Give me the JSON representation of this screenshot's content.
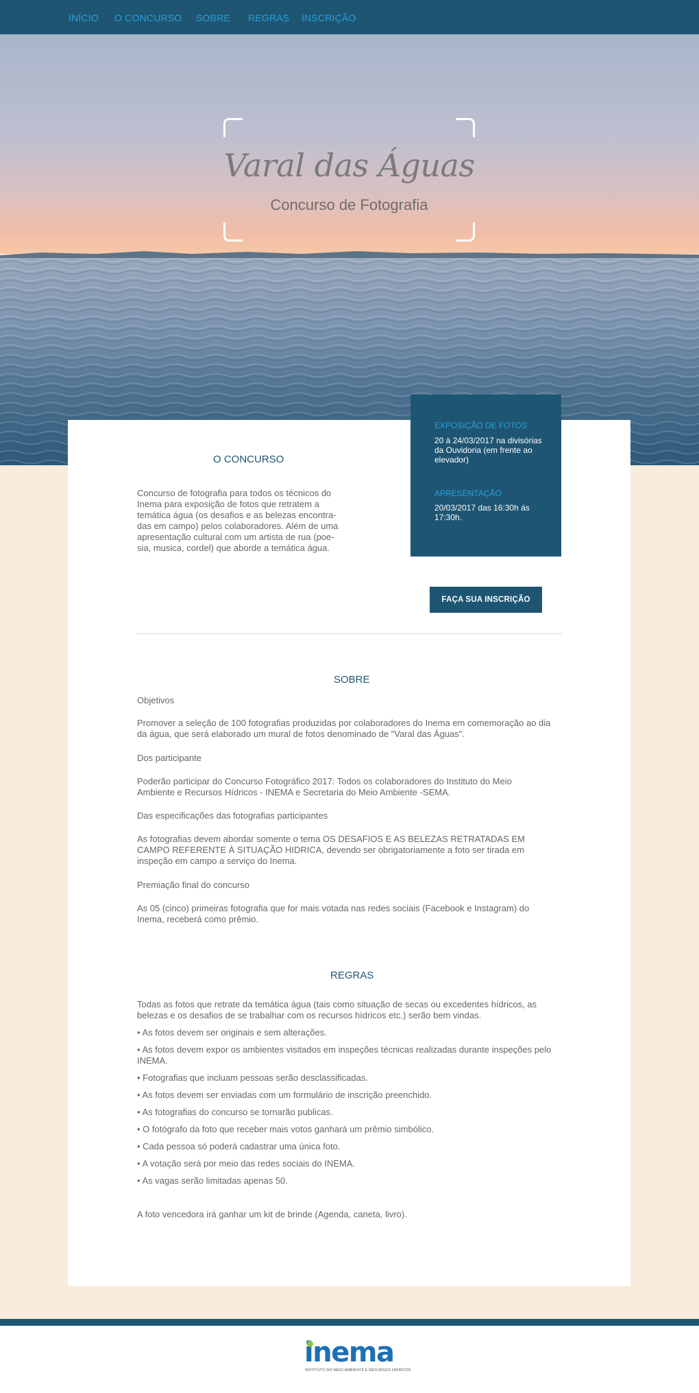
{
  "nav": {
    "items": [
      "INÍCIO",
      "O CONCURSO",
      "SOBRE",
      "REGRAS",
      "INSCRIÇÃO"
    ]
  },
  "hero": {
    "title": "Varal das Águas",
    "subtitle": "Concurso de Fotografia"
  },
  "info_box": {
    "exhibition_heading": "EXPOSIÇÃO DE FOTOS",
    "exhibition_text": "20 à 24/03/2017 na divisórias da Ouvidoria (em frente ao elevador)",
    "presentation_heading": "APRESENTAÇÃO",
    "presentation_text": "20/03/2017 das 16:30h ás 17:30h."
  },
  "concurso": {
    "title": "O CONCURSO",
    "text": "Concurso de fotografia para todos os técnicos do Inema para exposição de fotos que retratem a temática água (os desafios e as belezas encontra-das em campo) pelos colaboradores. Além de uma apresentação cultural com um artista de rua (poe-sia, musica, cordel) que aborde a temática água."
  },
  "cta": {
    "label": "FAÇA SUA INSCRIÇÃO"
  },
  "sobre": {
    "title": "SOBRE",
    "objetivos_label": "Objetivos",
    "objetivos_text": "Promover a seleção de 100 fotografias produzidas por colaboradores do Inema em comemoração ao dia da água, que será elaborado um mural de fotos denominado de \"Varal das Águas\".",
    "participantes_label": "Dos participante",
    "participantes_text": "Poderão participar do Concurso Fotográfico 2017: Todos os colaboradores do Instituto do Meio Ambiente e Recursos Hídricos - INEMA e Secretaria do Meio Ambiente -SEMA.",
    "especificacoes_label": "Das especificações das fotografias participantes",
    "especificacoes_text": "As fotografias devem abordar somente o tema OS DESAFIOS E AS BELEZAS RETRATADAS EM CAMPO REFERENTE À SITUAÇÃO HIDRICA, devendo ser obrigatoriamente a foto ser tirada em inspeção em campo a serviço do Inema.",
    "premiacao_label": "Premiação final do concurso",
    "premiacao_text": "As 05 (cinco) primeiras fotografia que for mais votada nas redes sociais (Facebook e Instagram) do Inema, receberá como prêmio."
  },
  "regras": {
    "title": "REGRAS",
    "intro": "Todas as fotos que retrate da temática água (tais como situação de secas ou excedentes hídricos, as belezas e os desafios de se trabalhar com os recursos hídricos etc.) serão bem vindas.",
    "items": [
      "• As fotos devem ser originais e sem alterações.",
      "• As fotos devem expor os ambientes visitados em inspeções técnicas realizadas durante inspeções pelo INEMA.",
      "• Fotografias que incluam pessoas serão desclassificadas.",
      "• As fotos devem ser enviadas com um formulário de inscrição preenchido.",
      "• As fotografias do concurso se tornarão publicas.",
      "• O fotógrafo da foto que receber mais votos ganhará um prêmio simbólico.",
      "• Cada pessoa só poderá cadastrar uma única foto.",
      "• A votação será por meio das redes sociais do INEMA.",
      "• As vagas serão limitadas apenas 50."
    ],
    "closing": "A foto vencedora irá ganhar um kit de brinde (Agenda, caneta, livro)."
  },
  "footer": {
    "logo_word": "inema",
    "logo_tagline": "INSTITUTO DO MEIO AMBIENTE E RECURSOS HÍDRICOS"
  },
  "colors": {
    "navy": "#1e5573",
    "accent_blue": "#2aa1d8",
    "cream": "#f8ecdd",
    "logo_blue": "#1d6fb3",
    "logo_green": "#8dc63f"
  }
}
